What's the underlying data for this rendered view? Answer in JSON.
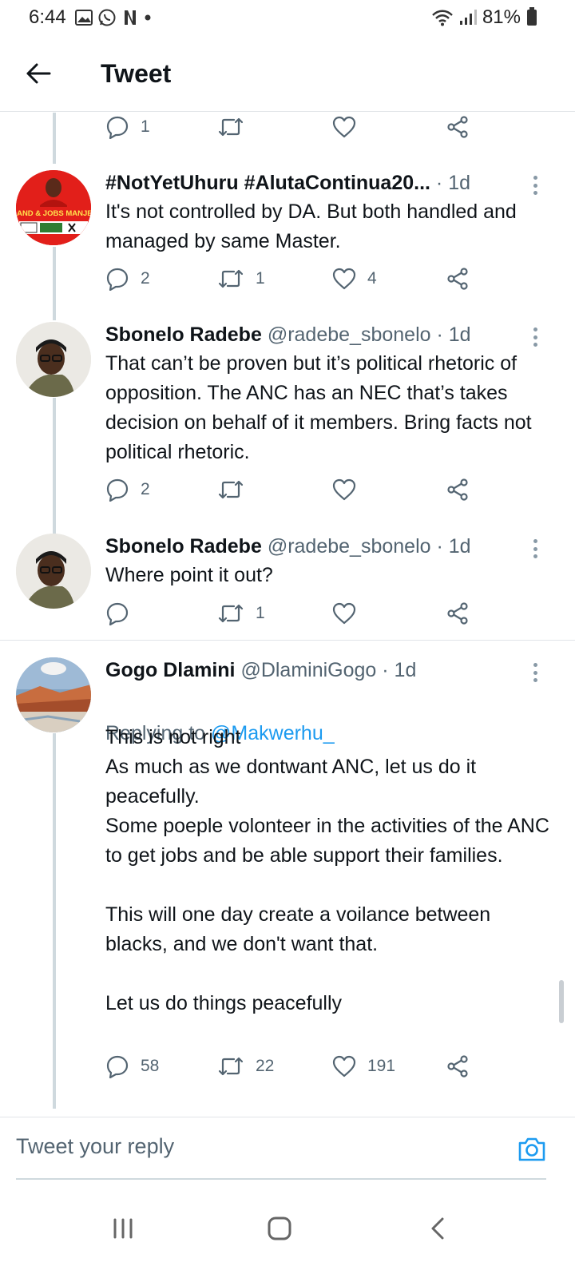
{
  "status_bar": {
    "time": "6:44",
    "battery": "81%"
  },
  "header": {
    "title": "Tweet"
  },
  "tweets": [
    {
      "name": "",
      "meta": "",
      "body": "",
      "stats": {
        "replies": "1",
        "retweets": "",
        "likes": ""
      }
    },
    {
      "name": "#NotYetUhuru #AlutaContinua20...",
      "meta": " · 1d",
      "body": "It's not controlled by DA. But both handled and managed by same Master.",
      "stats": {
        "replies": "2",
        "retweets": "1",
        "likes": "4"
      },
      "avatar_text": "LAND & JOBS MANJE!"
    },
    {
      "name": "Sbonelo Radebe",
      "meta": " @radebe_sbonelo · 1d",
      "body": "That can’t be proven but it’s political rhetoric of opposition. The ANC has an NEC that’s takes decision on behalf of it members. Bring facts not political rhetoric.",
      "stats": {
        "replies": "2",
        "retweets": "",
        "likes": ""
      }
    },
    {
      "name": "Sbonelo Radebe",
      "meta": " @radebe_sbonelo · 1d",
      "body": "Where point it out?",
      "stats": {
        "replies": "",
        "retweets": "1",
        "likes": ""
      }
    },
    {
      "name": "Gogo Dlamini",
      "meta": " @DlaminiGogo · 1d",
      "replying_label": "Replying to ",
      "replying_handle": "@Makwerhu_",
      "body": "This is not right\nAs much as we dontwant ANC, let us do it peacefully.\nSome poeple volonteer in the activities of the ANC to get jobs and be able support their families.\n\nThis will one day create a voilance between blacks, and we don't want that.\n\nLet us do things peacefully",
      "stats": {
        "replies": "58",
        "retweets": "22",
        "likes": "191"
      }
    }
  ],
  "composer": {
    "placeholder": "Tweet your reply"
  },
  "colors": {
    "accent": "#1d9bf0",
    "text": "#0f1419",
    "muted": "#536471",
    "divider": "#e1e4e8"
  },
  "icons": [
    "back-arrow-icon",
    "reply-icon",
    "retweet-icon",
    "like-icon",
    "share-icon",
    "more-icon",
    "camera-icon",
    "recents-icon",
    "home-icon",
    "nav-back-icon"
  ]
}
